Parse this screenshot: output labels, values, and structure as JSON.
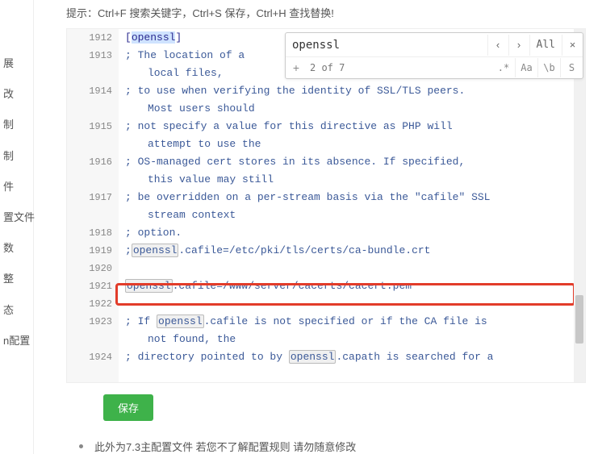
{
  "sidebar": {
    "items": [
      {
        "label": "展"
      },
      {
        "label": "改"
      },
      {
        "label": "制"
      },
      {
        "label": "制"
      },
      {
        "label": "件"
      },
      {
        "label": "置文件"
      },
      {
        "label": "数"
      },
      {
        "label": "整"
      },
      {
        "label": "态"
      },
      {
        "label": "n配置"
      }
    ]
  },
  "hint": "提示：Ctrl+F 搜索关键字，Ctrl+S 保存，Ctrl+H 查找替换!",
  "search": {
    "value": "openssl",
    "count": "2 of 7",
    "prev_label": "‹",
    "next_label": "›",
    "all_label": "All",
    "close_label": "×",
    "toggle_label": "+",
    "opt_regex": ".*",
    "opt_case": "Aa",
    "opt_word": "\\b",
    "opt_sel": "S"
  },
  "code": {
    "lines": [
      {
        "n": "1912",
        "kind": "section",
        "t1": "[",
        "hl": "openssl",
        "t2": "]"
      },
      {
        "n": "1913",
        "kind": "comment_wrap",
        "text": "; The location of a ",
        "wrap": "local files,"
      },
      {
        "n": "1914",
        "kind": "comment_wrap",
        "text": "; to use when verifying the identity of SSL/TLS peers.",
        "wrap": "Most users should"
      },
      {
        "n": "1915",
        "kind": "comment_wrap",
        "text": "; not specify a value for this directive as PHP will",
        "wrap": "attempt to use the"
      },
      {
        "n": "1916",
        "kind": "comment_wrap",
        "text": "; OS-managed cert stores in its absence. If specified,",
        "wrap": "this value may still"
      },
      {
        "n": "1917",
        "kind": "comment_wrap",
        "text": "; be overridden on a per-stream basis via the \"cafile\" SSL",
        "wrap": "stream context"
      },
      {
        "n": "1918",
        "kind": "comment",
        "text": "; option."
      },
      {
        "n": "1919",
        "kind": "setting",
        "pre": ";",
        "hl": "openssl",
        "post": ".cafile=/etc/pki/tls/certs/ca-bundle.crt"
      },
      {
        "n": "1920",
        "kind": "blank",
        "text": ""
      },
      {
        "n": "1921",
        "kind": "setting_mark",
        "hl": "openssl",
        "post": ".cafile=/www/server/cacerts/cacert.pem"
      },
      {
        "n": "1922",
        "kind": "blank",
        "text": ""
      },
      {
        "n": "1923",
        "kind": "comment_hl_wrap",
        "pre": "; If ",
        "hl": "openssl",
        "mid": ".cafile is not specified or if the CA file is",
        "wrap": "not found, the"
      },
      {
        "n": "1924",
        "kind": "comment_hl",
        "pre": "; directory pointed to by ",
        "hl": "openssl",
        "post": ".capath is searched for a"
      }
    ]
  },
  "save_label": "保存",
  "footer": "此外为7.3主配置文件 若您不了解配置规则 请勿随意修改"
}
